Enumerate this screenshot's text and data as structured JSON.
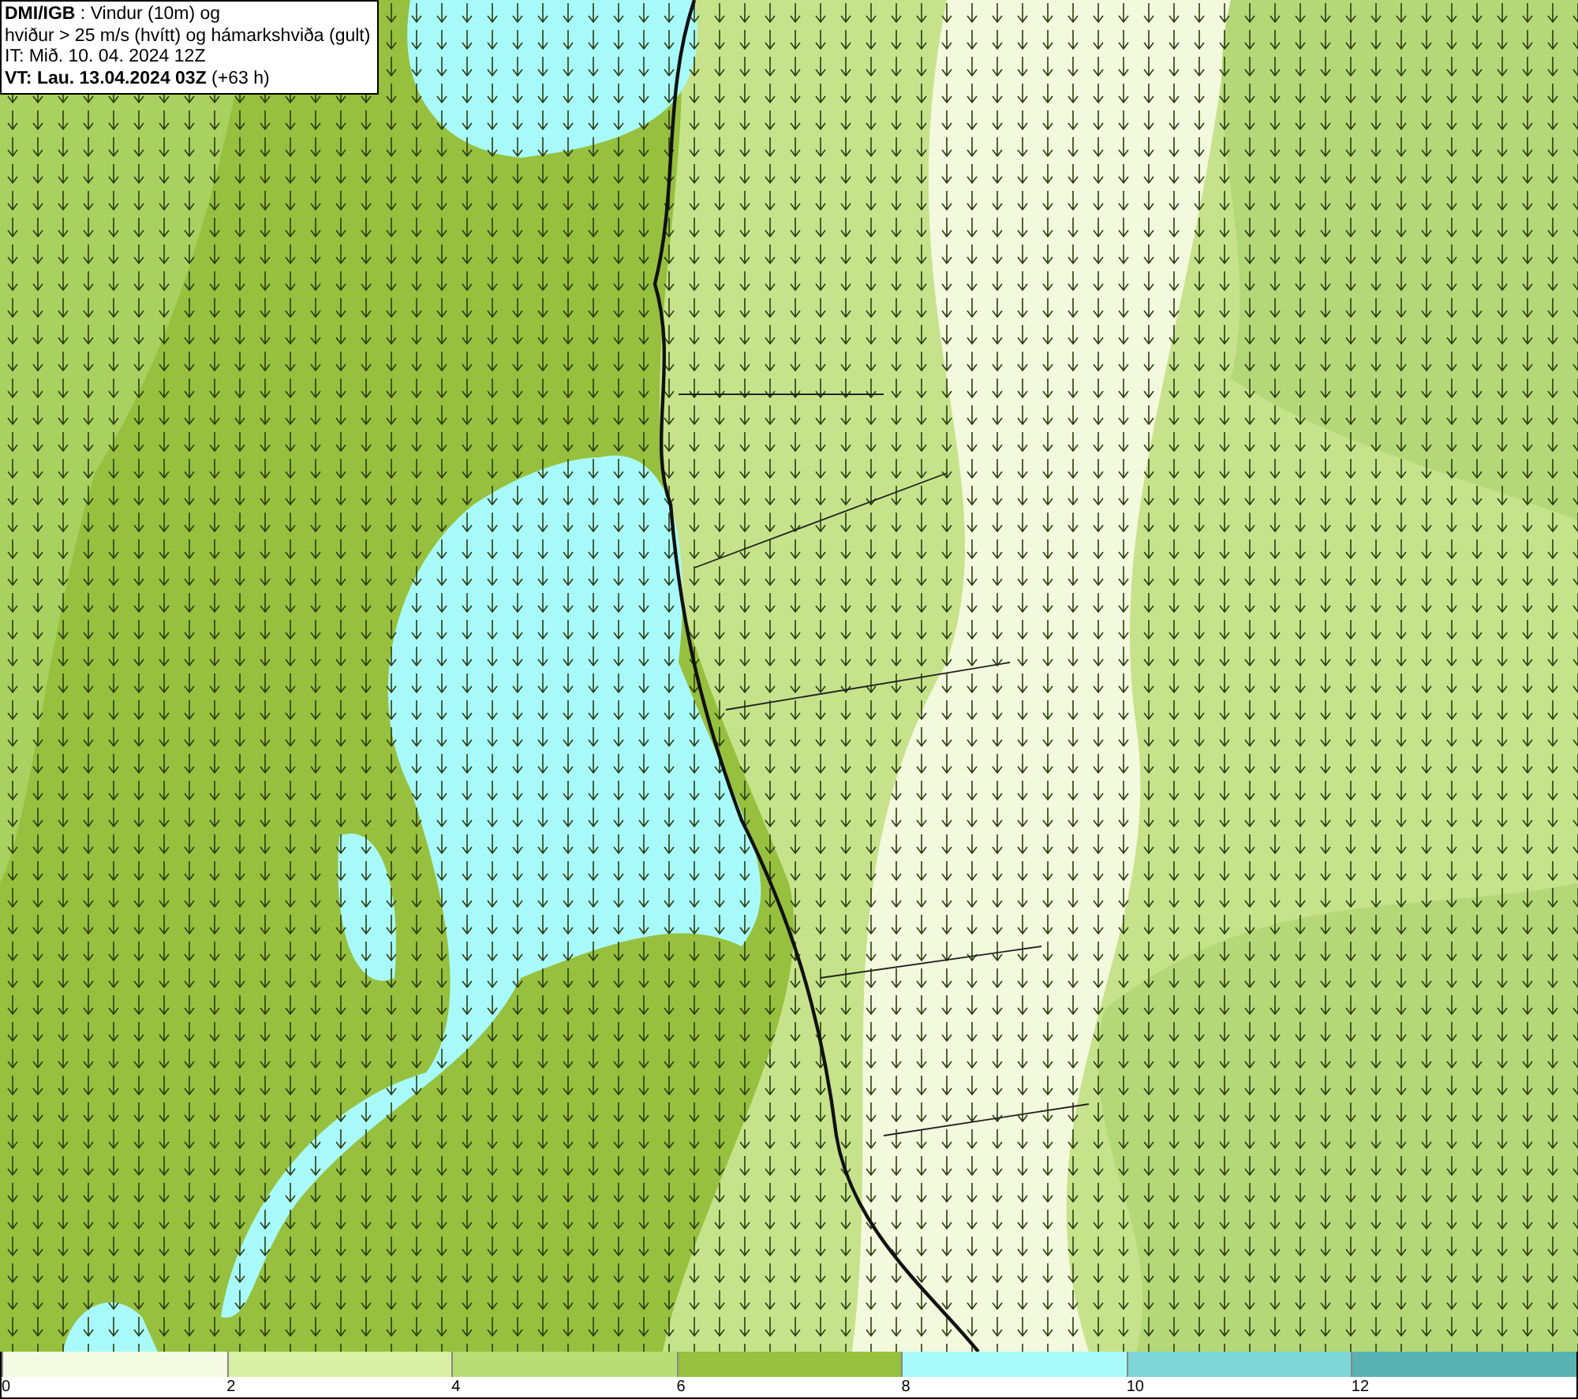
{
  "title_box": {
    "lines": [
      "**DMI/IGB** : Vindur (10m) og",
      "hviður > 25 m/s (hvítt) og hámarkshviða (gult)",
      "IT: Mið. 10. 04. 2024 12Z",
      "**VT: Lau. 13.04.2024 03Z** (+63 h)"
    ]
  },
  "legend": {
    "bins": [
      {
        "color": "#f5fbe2",
        "label": "0"
      },
      {
        "color": "#d9efa4",
        "label": "2"
      },
      {
        "color": "#b8dc76",
        "label": "4"
      },
      {
        "color": "#96c03e",
        "label": "6"
      },
      {
        "color": "#a8fafa",
        "label": "8"
      },
      {
        "color": "#7ed6d6",
        "label": "10"
      },
      {
        "color": "#58b2b2",
        "label": "12"
      }
    ]
  }
}
